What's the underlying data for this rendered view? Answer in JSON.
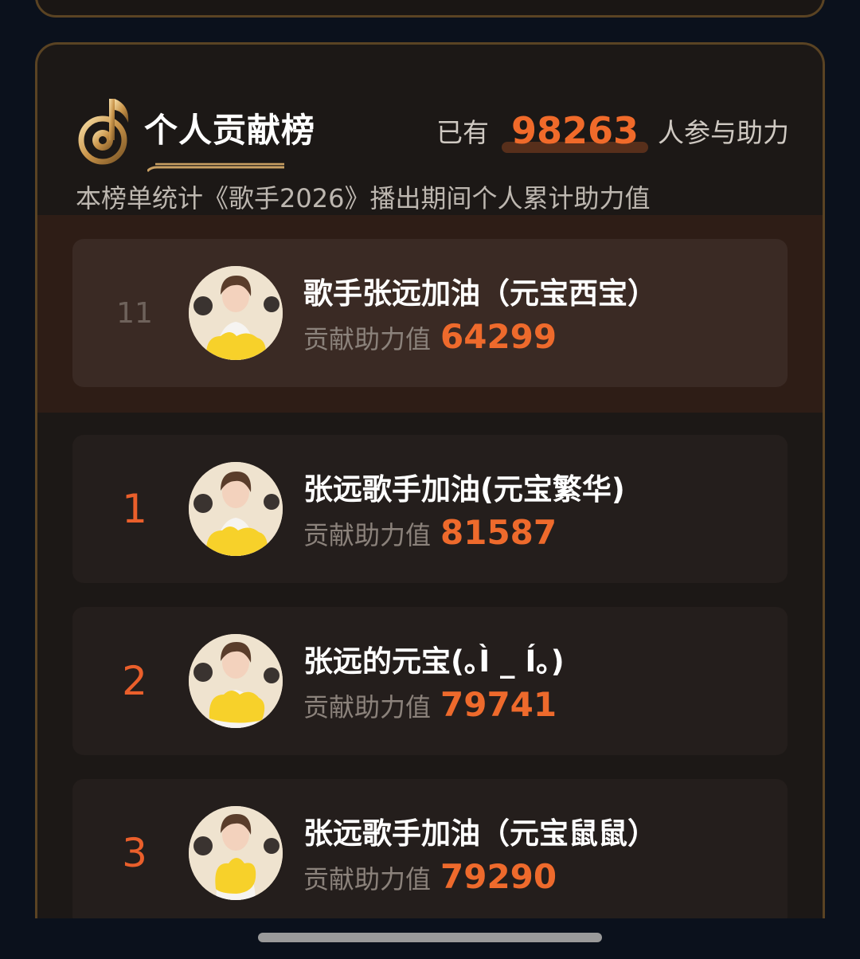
{
  "header": {
    "title": "个人贡献榜",
    "participants_prefix": "已有",
    "participants_count": "98263",
    "participants_suffix": "人参与助力",
    "subtitle": "本榜单统计《歌手2026》播出期间个人累计助力值"
  },
  "value_label": "贡献助力值",
  "my_entry": {
    "rank": "11",
    "name": "歌手张远加油（元宝西宝）",
    "value": "64299"
  },
  "entries": [
    {
      "rank": "1",
      "name": "张远歌手加油(元宝繁华)",
      "value": "81587"
    },
    {
      "rank": "2",
      "name": "张远的元宝(｡Ì _ Í｡)",
      "value": "79741"
    },
    {
      "rank": "3",
      "name": "张远歌手加油（元宝鼠鼠）",
      "value": "79290"
    }
  ],
  "colors": {
    "accent": "#ee6a2c",
    "gold": "#c9a063",
    "background": "#0b111c"
  },
  "icons": {
    "header": "music-note-trophy-icon",
    "avatar": "user-avatar"
  }
}
